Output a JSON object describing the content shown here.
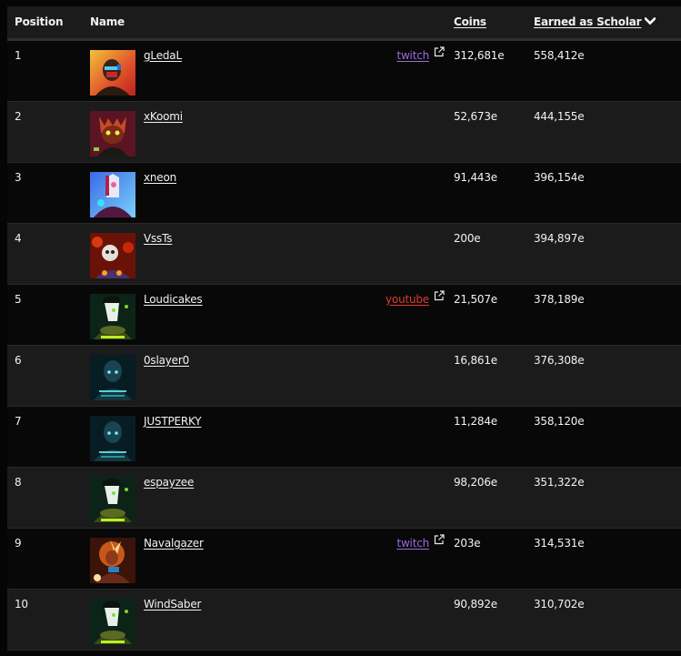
{
  "table": {
    "headers": {
      "position": "Position",
      "name": "Name",
      "coins": "Coins",
      "earned": "Earned as Scholar",
      "sort_indicator": "chevron-down-icon"
    },
    "colors": {
      "twitch": "#9b6bd9",
      "youtube": "#e03a2e"
    },
    "rows": [
      {
        "position": "1",
        "name": "gLedaL",
        "social": "twitch",
        "coins": "312,681e",
        "earned": "558,412e",
        "avatar": "red-yellow-masked-hero"
      },
      {
        "position": "2",
        "name": "xKoomi",
        "social": "",
        "coins": "52,673e",
        "earned": "444,155e",
        "avatar": "red-horned-demon"
      },
      {
        "position": "3",
        "name": "xneon",
        "social": "",
        "coins": "91,443e",
        "earned": "396,154e",
        "avatar": "blue-white-armored-hero"
      },
      {
        "position": "4",
        "name": "VssTs",
        "social": "",
        "coins": "200e",
        "earned": "394,897e",
        "avatar": "skull-fire"
      },
      {
        "position": "5",
        "name": "Loudicakes",
        "social": "youtube",
        "coins": "21,507e",
        "earned": "378,189e",
        "avatar": "green-glowing-mask"
      },
      {
        "position": "6",
        "name": "0slayer0",
        "social": "",
        "coins": "16,861e",
        "earned": "376,308e",
        "avatar": "teal-armored-knight"
      },
      {
        "position": "7",
        "name": "JUSTPERKY",
        "social": "",
        "coins": "11,284e",
        "earned": "358,120e",
        "avatar": "teal-armored-knight"
      },
      {
        "position": "8",
        "name": "espayzee",
        "social": "",
        "coins": "98,206e",
        "earned": "351,322e",
        "avatar": "green-glowing-mask"
      },
      {
        "position": "9",
        "name": "Navalgazer",
        "social": "twitch",
        "coins": "203e",
        "earned": "314,531e",
        "avatar": "orange-flame-warrior"
      },
      {
        "position": "10",
        "name": "WindSaber",
        "social": "",
        "coins": "90,892e",
        "earned": "310,702e",
        "avatar": "green-glowing-mask"
      }
    ]
  }
}
